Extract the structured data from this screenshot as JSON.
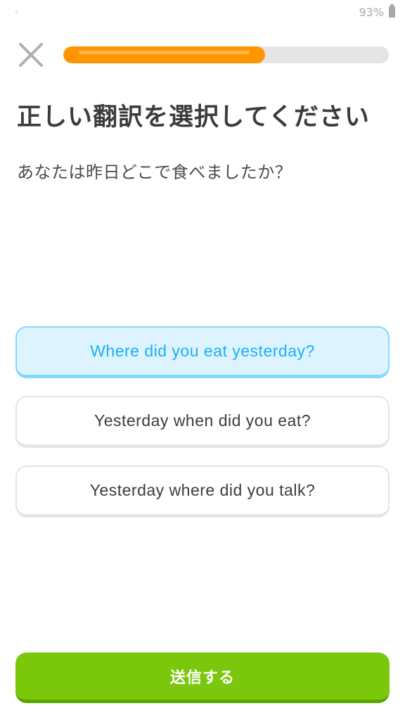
{
  "status_bar": {
    "battery_percent": "93%",
    "battery_icon": "battery-icon"
  },
  "header": {
    "close_icon": "close-icon",
    "progress": 0.62,
    "colors": {
      "track": "#e5e5e5",
      "fill": "#ff9600"
    }
  },
  "exercise": {
    "title": "正しい翻訳を選択してください",
    "prompt": "あなたは昨日どこで食べましたか？",
    "choices": [
      {
        "label": "Where did you eat yesterday?",
        "selected": true
      },
      {
        "label": "Yesterday when did you eat?",
        "selected": false
      },
      {
        "label": "Yesterday where did you talk?",
        "selected": false
      }
    ],
    "colors": {
      "selected_border": "#84d8ff",
      "selected_text": "#1cb0f6",
      "selected_bg": "#ddf4ff"
    }
  },
  "footer": {
    "submit_label": "送信する",
    "submit_color": "#7ac70c"
  }
}
